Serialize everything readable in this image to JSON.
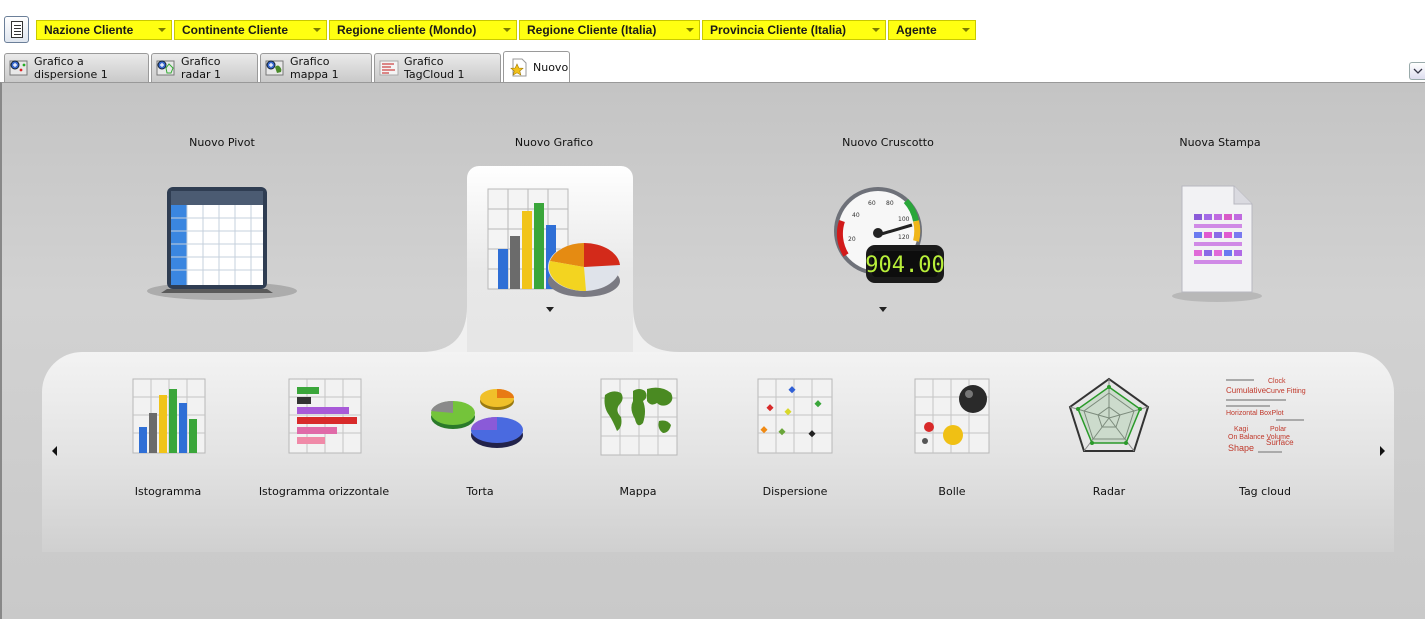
{
  "toolbar": {
    "filters": [
      "Nazione Cliente",
      "Continente Cliente",
      "Regione cliente (Mondo)",
      "Regione Cliente (Italia)",
      "Provincia Cliente (Italia)",
      "Agente"
    ]
  },
  "tabs": [
    {
      "label": "Grafico a dispersione 1",
      "icon": "scatter-chart-icon"
    },
    {
      "label": "Grafico radar 1",
      "icon": "radar-chart-icon"
    },
    {
      "label": "Grafico mappa 1",
      "icon": "map-chart-icon"
    },
    {
      "label": "Grafico TagCloud 1",
      "icon": "tag-cloud-icon"
    },
    {
      "label": "Nuovo",
      "icon": "star-document-icon",
      "active": true
    }
  ],
  "categories": [
    {
      "label": "Nuovo Pivot",
      "icon": "pivot-table-icon"
    },
    {
      "label": "Nuovo Grafico",
      "icon": "chart-icon",
      "selected": true
    },
    {
      "label": "Nuovo Cruscotto",
      "icon": "gauge-icon",
      "gauge_readout": "904.00",
      "gauge_ticks": [
        "20",
        "40",
        "60",
        "80",
        "100",
        "120"
      ]
    },
    {
      "label": "Nuova Stampa",
      "icon": "report-document-icon"
    }
  ],
  "chart_types": [
    {
      "label": "Istogramma",
      "icon": "histogram-icon"
    },
    {
      "label": "Istogramma orizzontale",
      "icon": "horizontal-histogram-icon"
    },
    {
      "label": "Torta",
      "icon": "pie-icon"
    },
    {
      "label": "Mappa",
      "icon": "world-map-icon"
    },
    {
      "label": "Dispersione",
      "icon": "scatter-icon"
    },
    {
      "label": "Bolle",
      "icon": "bubble-icon"
    },
    {
      "label": "Radar",
      "icon": "radar-icon"
    },
    {
      "label": "Tag cloud",
      "icon": "tag-cloud-icon"
    }
  ],
  "tag_cloud_words": [
    "Clock",
    "Cumulative",
    "Curve Fitting",
    "Horizontal BoxPlot",
    "Kagi",
    "On Balance Volume",
    "Polar",
    "Surface",
    "Shape"
  ],
  "colors": {
    "filter_bg": "#ffff11",
    "panel_bg": "#c9c9c9",
    "highlight_bg": "#ffffff"
  }
}
